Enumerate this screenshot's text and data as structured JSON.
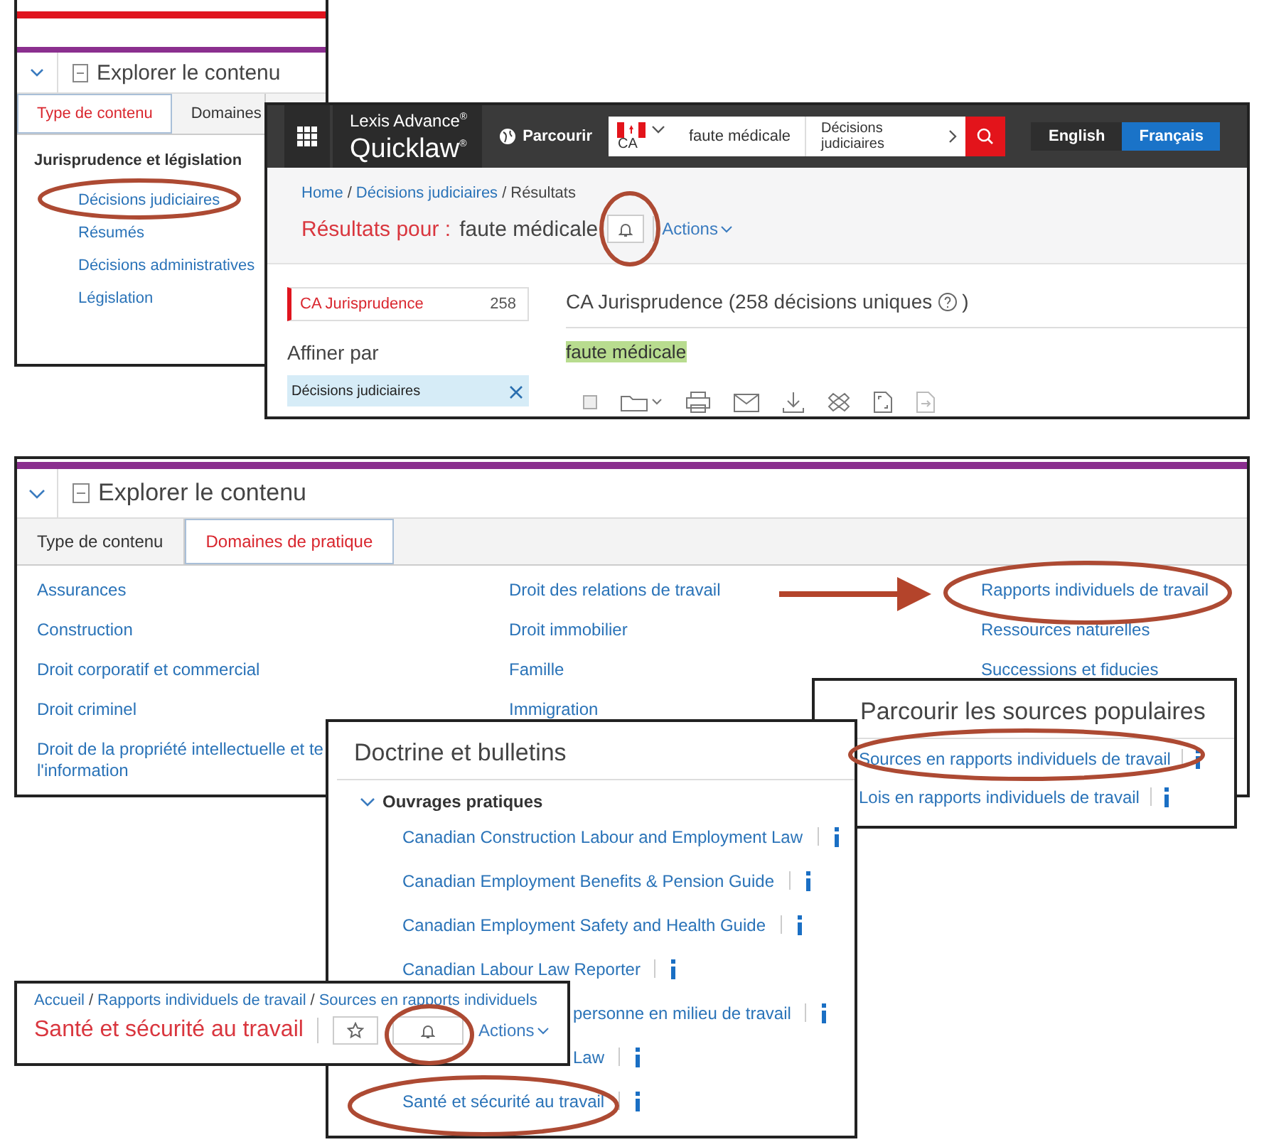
{
  "content_type_panel": {
    "header": "Explorer le contenu",
    "tabs": [
      {
        "label": "Type de contenu",
        "selected": true
      },
      {
        "label": "Domaines",
        "selected": false
      }
    ],
    "group": "Jurisprudence et législation",
    "links": [
      "Décisions judiciaires",
      "Résumés",
      "Décisions administratives",
      "Législation"
    ]
  },
  "results_window": {
    "logo_top": "Lexis Advance$^{®}$",
    "logo_bottom": "Quicklaw$^{®}$",
    "browse": "Parcourir",
    "jurisdiction": "CA",
    "search_value": "faute médicale",
    "search_scope": "Décisions judiciaires",
    "languages": [
      {
        "label": "English",
        "selected": false
      },
      {
        "label": "Français",
        "selected": true
      }
    ],
    "breadcrumb": [
      {
        "kind": "link",
        "text": "Home"
      },
      {
        "kind": "separator",
        "text": "/"
      },
      {
        "kind": "link",
        "text": "Décisions judiciaires"
      },
      {
        "kind": "separator",
        "text": "/"
      },
      {
        "kind": "current",
        "text": "Résultats"
      }
    ],
    "results_label": "Résultats pour :",
    "query": "faute médicale",
    "actions": "Actions",
    "filters": [
      {
        "label": "CA Jurisprudence",
        "count": "258",
        "selected": true
      }
    ],
    "refine_label": "Affiner par",
    "applied_filter": "Décisions judiciaires",
    "heading": "CA Jurisprudence (258 décisions uniques",
    "heading_close": ")",
    "highlighted_term": "faute médicale",
    "select_all": {
      "checked": false
    }
  },
  "practice_panel": {
    "header": "Explorer le contenu",
    "tabs": [
      {
        "label": "Type de contenu",
        "selected": false
      },
      {
        "label": "Domaines de pratique",
        "selected": true
      }
    ],
    "columns": [
      [
        {
          "kind": "link",
          "text": "Assurances"
        },
        {
          "kind": "link",
          "text": "Construction"
        },
        {
          "kind": "link",
          "text": "Droit corporatif et commercial"
        },
        {
          "kind": "link",
          "text": "Droit criminel"
        },
        {
          "kind": "link",
          "text": "Droit de la propriété intellectuelle et te"
        },
        {
          "kind": "wrap",
          "text": "l'information"
        }
      ],
      [
        {
          "kind": "link",
          "text": "Droit des relations de travail"
        },
        {
          "kind": "link",
          "text": "Droit immobilier"
        },
        {
          "kind": "link",
          "text": "Famille"
        },
        {
          "kind": "link",
          "text": "Immigration"
        }
      ],
      [
        {
          "kind": "link",
          "text": "Rapports individuels de travail"
        },
        {
          "kind": "link",
          "text": "Ressources naturelles"
        },
        {
          "kind": "link",
          "text": "Successions et fiducies"
        }
      ]
    ]
  },
  "popular_sources": {
    "title": "Parcourir les sources populaires",
    "items": [
      "Sources en rapports individuels de travail",
      "Lois en rapports individuels de travail"
    ]
  },
  "doctrine": {
    "title": "Doctrine et bulletins",
    "section": {
      "label": "Ouvrages pratiques",
      "expanded": true
    },
    "items": [
      {
        "kind": "full",
        "text": "Canadian Construction Labour and Employment Law"
      },
      {
        "kind": "full",
        "text": "Canadian Employment Benefits & Pension Guide"
      },
      {
        "kind": "full",
        "text": "Canadian Employment Safety and Health Guide"
      },
      {
        "kind": "full",
        "text": "Canadian Labour Law Reporter"
      },
      {
        "kind": "covered",
        "text": "personne en milieu de travail"
      },
      {
        "kind": "covered",
        "text": "Law"
      },
      {
        "kind": "full",
        "text": "Santé et sécurité au travail"
      }
    ]
  },
  "source_page": {
    "breadcrumb": [
      {
        "kind": "link",
        "text": "Accueil"
      },
      {
        "kind": "separator",
        "text": "/"
      },
      {
        "kind": "link",
        "text": "Rapports individuels de travail"
      },
      {
        "kind": "separator",
        "text": "/"
      },
      {
        "kind": "link",
        "text": "Sources en rapports individuels"
      }
    ],
    "title": "Santé et sécurité au travail",
    "actions": "Actions"
  },
  "annotations": [
    {
      "kind": "ellipse"
    },
    {
      "kind": "ellipse"
    },
    {
      "kind": "arrow"
    },
    {
      "kind": "ellipse"
    },
    {
      "kind": "ellipse"
    },
    {
      "kind": "ellipse"
    },
    {
      "kind": "ellipse"
    }
  ]
}
